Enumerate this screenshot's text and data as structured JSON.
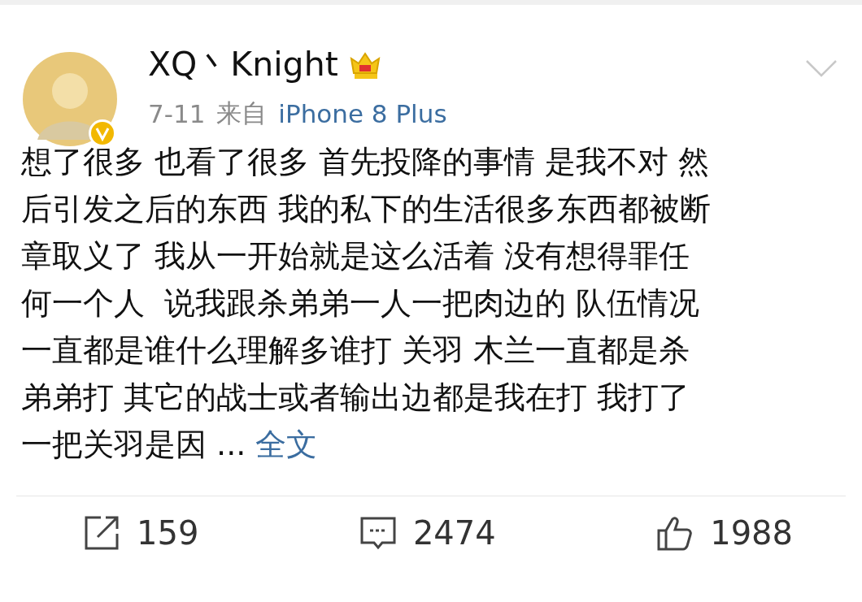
{
  "post": {
    "author": "XQ丶Knight",
    "date": "7-11",
    "source_prefix": "来自",
    "source": "iPhone 8 Plus",
    "body_lines": [
      "想了很多 也看了很多 首先投降的事情 是我不对 然",
      "后引发之后的东西 我的私下的生活很多东西都被断",
      "章取义了 我从一开始就是这么活着 没有想得罪任",
      "何一个人  说我跟杀弟弟一人一把肉边的 队伍情况",
      "一直都是谁什么理解多谁打 关羽 木兰一直都是杀",
      "弟弟打 其它的战士或者输出边都是我在打 我打了",
      "一把关羽是因 ..."
    ],
    "more_link": "全文"
  },
  "actions": [
    {
      "kind": "repost",
      "count": "159"
    },
    {
      "kind": "comment",
      "count": "2474"
    },
    {
      "kind": "like",
      "count": "1988"
    }
  ]
}
